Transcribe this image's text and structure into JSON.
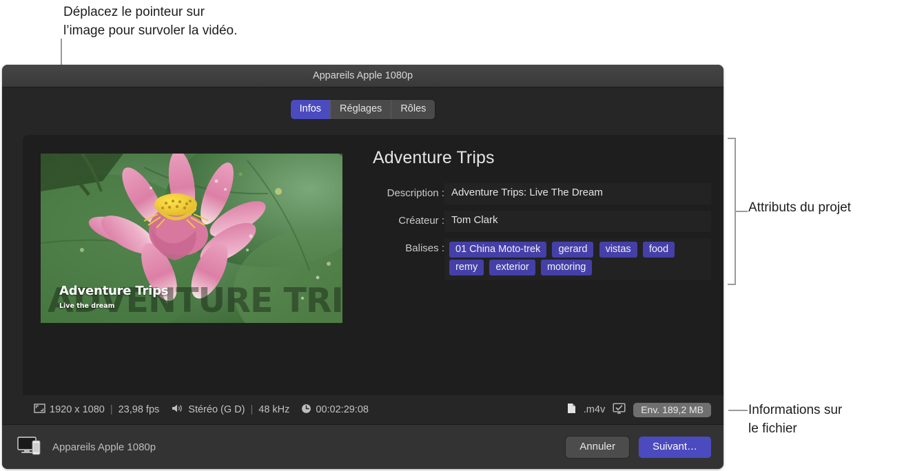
{
  "annotations": {
    "top_callout": "Déplacez le pointeur sur\nl’image pour survoler la vidéo.",
    "attributes_callout": "Attributs du projet",
    "file_info_callout": "Informations sur\nle fichier"
  },
  "window": {
    "title": "Appareils Apple 1080p",
    "tabs": [
      {
        "label": "Infos",
        "active": true
      },
      {
        "label": "Réglages",
        "active": false
      },
      {
        "label": "Rôles",
        "active": false
      }
    ]
  },
  "thumbnail": {
    "overlay_title": "Adventure Trips",
    "overlay_subtitle": "Live the dream",
    "watermark": "ADVENTURE TRIPS"
  },
  "attributes": {
    "project_title": "Adventure Trips",
    "description_label": "Description :",
    "description_value": "Adventure Trips: Live The Dream",
    "creator_label": "Créateur :",
    "creator_value": "Tom Clark",
    "tags_label": "Balises :",
    "tags": [
      "01 China Moto-trek",
      "gerard",
      "vistas",
      "food",
      "remy",
      "exterior",
      "motoring"
    ]
  },
  "status_bar": {
    "resolution": "1920 x 1080",
    "framerate": "23,98 fps",
    "audio_channels": "Stéréo (G D)",
    "sample_rate": "48 kHz",
    "duration": "00:02:29:08",
    "file_extension": ".m4v",
    "estimated_size": "Env. 189,2 MB",
    "separator": "|"
  },
  "footer": {
    "destination": "Appareils Apple 1080p",
    "cancel_label": "Annuler",
    "next_label": "Suivant…"
  },
  "colors": {
    "accent": "#4b4bbf",
    "tag": "#4540a8",
    "window_bg": "#242424",
    "panel_bg": "#1e1e1e"
  }
}
